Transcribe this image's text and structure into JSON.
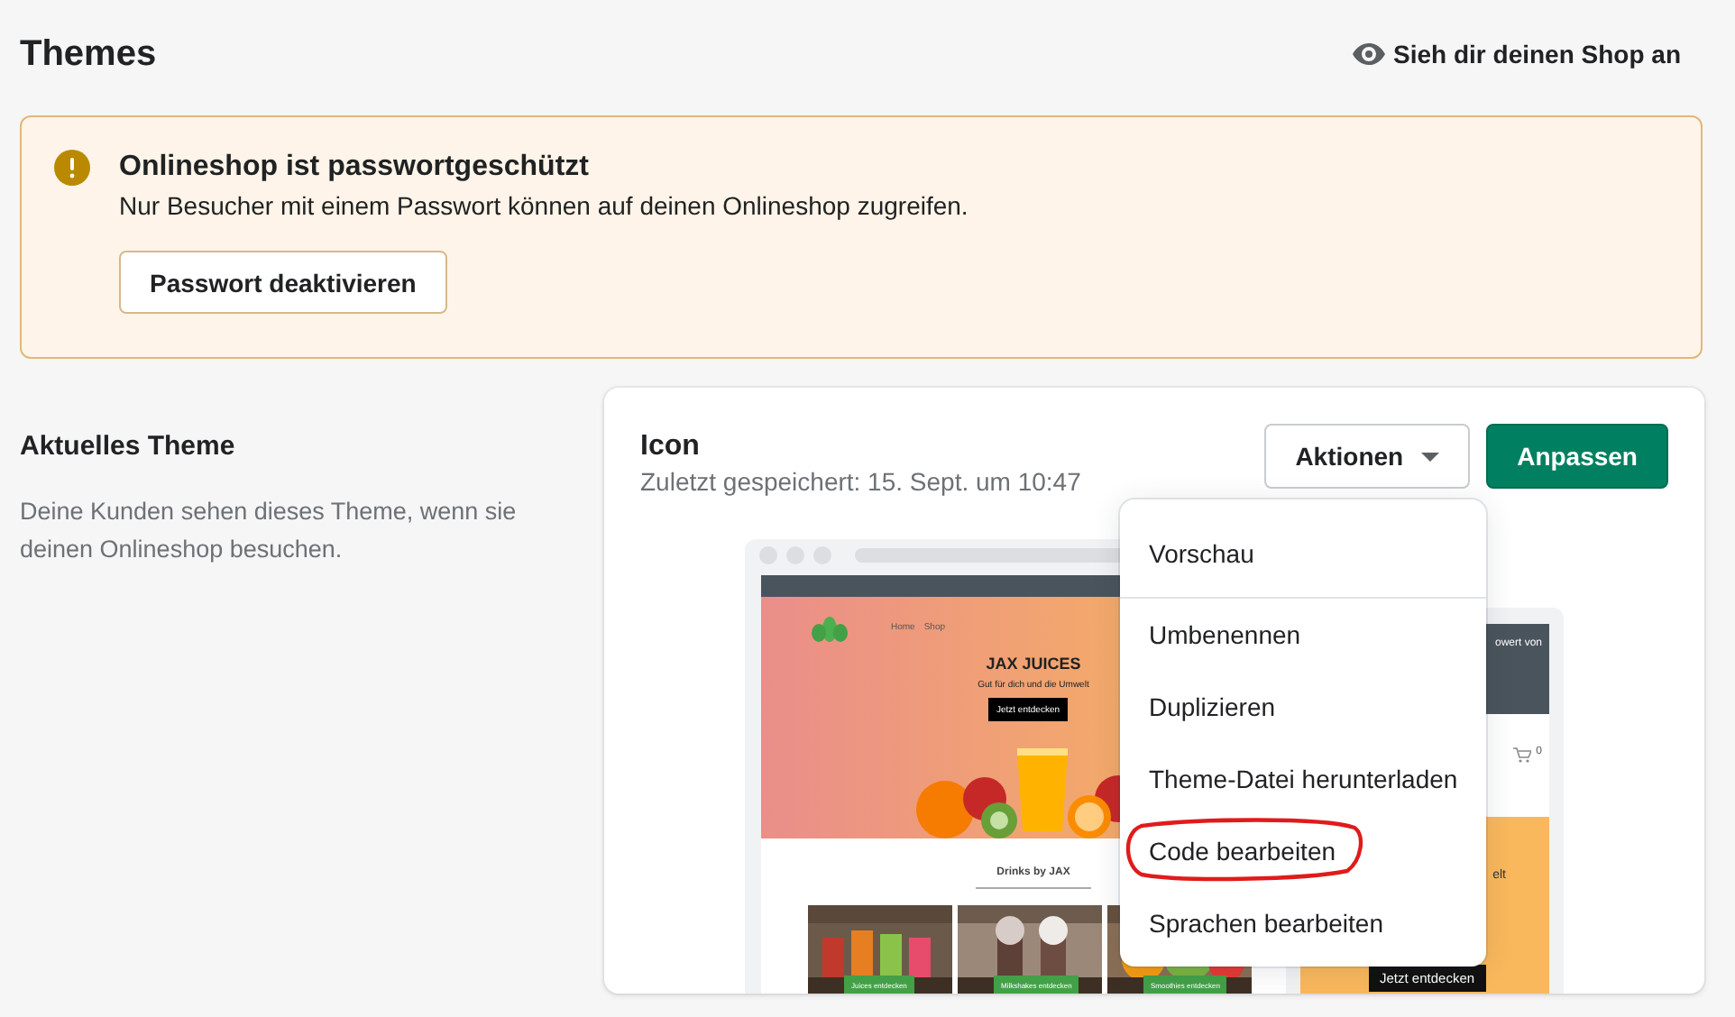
{
  "header": {
    "title": "Themes",
    "view_shop_link": "Sieh dir deinen Shop an"
  },
  "banner": {
    "title": "Onlineshop ist passwortgeschützt",
    "text": "Nur Besucher mit einem Passwort können auf deinen Onlineshop zugreifen.",
    "button": "Passwort deaktivieren"
  },
  "current_theme": {
    "heading": "Aktuelles Theme",
    "description": "Deine Kunden sehen dieses Theme, wenn sie deinen Onlineshop besuchen."
  },
  "theme_card": {
    "name": "Icon",
    "saved": "Zuletzt gespeichert: 15. Sept. um 10:47",
    "actions_button": "Aktionen",
    "customize_button": "Anpassen",
    "preview": {
      "desktop": {
        "nav": [
          "Home",
          "Shop"
        ],
        "hero_title": "JAX JUICES",
        "hero_subtitle": "Gut für dich und die Umwelt",
        "hero_button": "Jetzt entdecken",
        "section_title": "Drinks by JAX",
        "products": [
          {
            "button": "Juices entdecken"
          },
          {
            "button": "Milkshakes entdecken"
          },
          {
            "button": "Smoothies entdecken"
          }
        ]
      },
      "mobile": {
        "banner": "owert von",
        "cart_count": "0",
        "text": "elt",
        "button": "Jetzt entdecken"
      }
    },
    "actions_menu": {
      "sections": [
        {
          "items": [
            {
              "label": "Vorschau",
              "highlighted": false
            }
          ]
        },
        {
          "items": [
            {
              "label": "Umbenennen",
              "highlighted": false
            },
            {
              "label": "Duplizieren",
              "highlighted": false
            },
            {
              "label": "Theme-Datei herunterladen",
              "highlighted": false
            },
            {
              "label": "Code bearbeiten",
              "highlighted": true
            },
            {
              "label": "Sprachen bearbeiten",
              "highlighted": false
            }
          ]
        }
      ]
    }
  }
}
